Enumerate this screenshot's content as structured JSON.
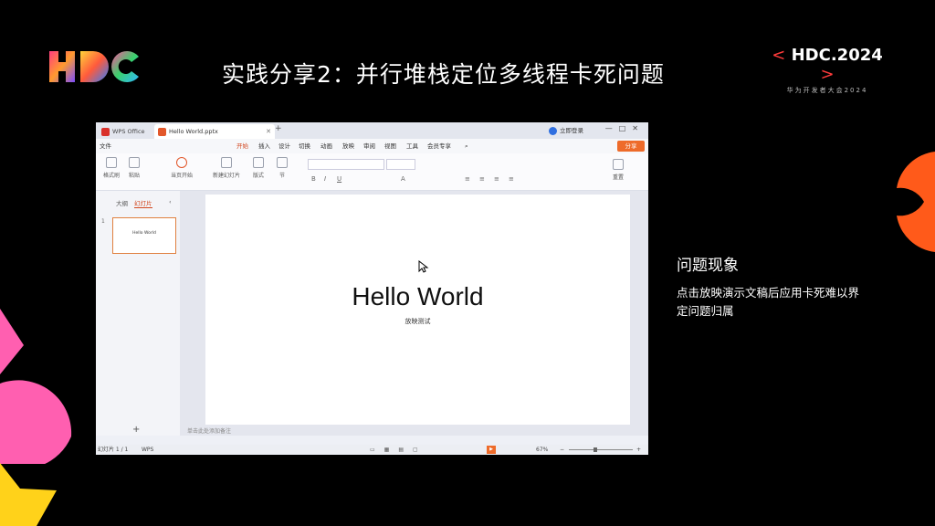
{
  "header": {
    "title": "实践分享2：并行堆栈定位多线程卡死问题",
    "badge_main": "HDC.2024",
    "badge_left": "<",
    "badge_right": ">",
    "badge_sub": "华为开发者大会2024"
  },
  "right_panel": {
    "heading": "问题现象",
    "desc": "点击放映演示文稿后应用卡死难以界定问题归属"
  },
  "wps": {
    "tabs": [
      {
        "label": "WPS Office"
      },
      {
        "label": "Hello World.pptx"
      }
    ],
    "user_label": "立即登录",
    "menu": [
      "文件",
      "开始",
      "插入",
      "设计",
      "切换",
      "动画",
      "放映",
      "审阅",
      "视图",
      "工具",
      "会员专享"
    ],
    "active_menu": "开始",
    "share_label": "分享",
    "ribbon": {
      "format_painter": "格式刷",
      "paste": "粘贴",
      "play_current": "当页开始",
      "new_slide": "新建幻灯片",
      "layout": "版式",
      "section": "节",
      "reset": "重置"
    },
    "left_panel": {
      "tab_outline": "大纲",
      "tab_slides": "幻灯片",
      "thumb_number": "1",
      "thumb_text": "Hello World"
    },
    "slide": {
      "title": "Hello World",
      "subtitle": "放映测试"
    },
    "notes_placeholder": "单击此处添加备注",
    "status": {
      "slide_count": "幻灯片 1 / 1",
      "app": "WPS",
      "zoom": "67%"
    }
  },
  "colors": {
    "background": "#000000",
    "accent_orange": "#ee6b2a",
    "badge_red": "#ff3b3b"
  }
}
